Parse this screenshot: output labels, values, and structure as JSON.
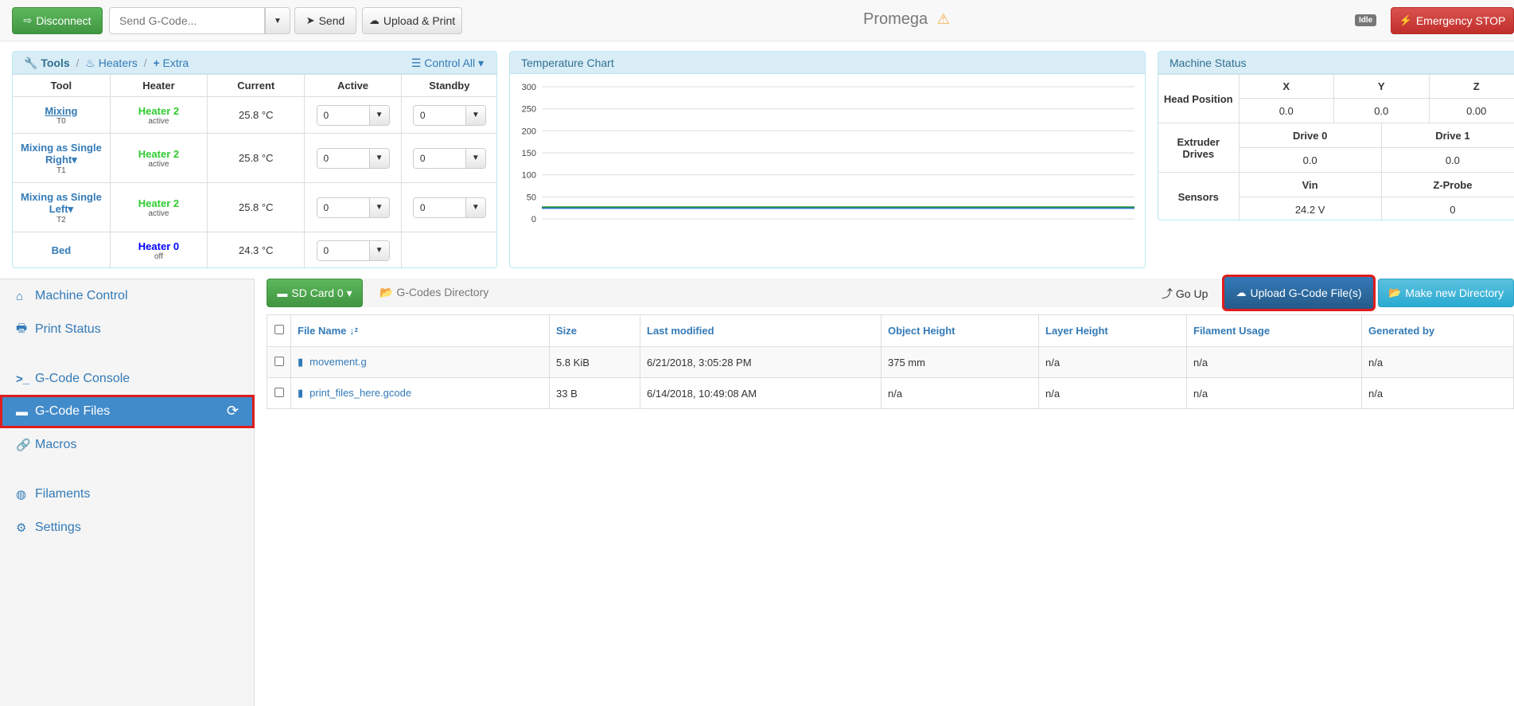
{
  "topbar": {
    "disconnect_label": "Disconnect",
    "gcode_placeholder": "Send G-Code...",
    "send_label": "Send",
    "upload_print_label": "Upload & Print",
    "machine_name": "Promega",
    "status_badge": "Idle",
    "emergency_label": "Emergency STOP"
  },
  "tools_panel": {
    "tab_tools": "Tools",
    "tab_heaters": "Heaters",
    "tab_extra": "Extra",
    "control_all": "Control All",
    "columns": [
      "Tool",
      "Heater",
      "Current",
      "Active",
      "Standby"
    ],
    "rows": [
      {
        "tool": "Mixing",
        "tool_sub": "T0",
        "heater": "Heater 2",
        "heater_state": "active",
        "current": "25.8 °C",
        "active": "0",
        "standby": "0"
      },
      {
        "tool": "Mixing as Single Right",
        "tool_sub": "T1",
        "heater": "Heater 2",
        "heater_state": "active",
        "current": "25.8 °C",
        "active": "0",
        "standby": "0"
      },
      {
        "tool": "Mixing as Single Left",
        "tool_sub": "T2",
        "heater": "Heater 2",
        "heater_state": "active",
        "current": "25.8 °C",
        "active": "0",
        "standby": "0"
      },
      {
        "tool": "Bed",
        "tool_sub": "",
        "heater": "Heater 0",
        "heater_state": "off",
        "current": "24.3 °C",
        "active": "0",
        "standby": ""
      }
    ]
  },
  "temperature_chart": {
    "title": "Temperature Chart",
    "chart_data": {
      "type": "line",
      "ylim": [
        0,
        300
      ],
      "y_ticks": [
        300,
        250,
        200,
        150,
        100,
        50,
        0
      ],
      "grid": true,
      "series": [
        {
          "color": "#2b9a2b",
          "values": [
            25.8,
            25.8,
            25.8,
            25.8,
            25.8,
            25.8,
            25.8,
            25.8,
            25.8,
            25.8,
            25.8,
            25.8
          ]
        },
        {
          "color": "#1f6fd1",
          "values": [
            24.3,
            24.3,
            24.3,
            24.3,
            24.3,
            24.3,
            24.3,
            24.3,
            24.3,
            24.3,
            24.3,
            24.3
          ]
        }
      ]
    }
  },
  "machine_status": {
    "title": "Machine Status",
    "head_position_label": "Head Position",
    "axes": [
      {
        "name": "X",
        "value": "0.0"
      },
      {
        "name": "Y",
        "value": "0.0"
      },
      {
        "name": "Z",
        "value": "0.00"
      }
    ],
    "extruder_label": "Extruder Drives",
    "drives": [
      {
        "name": "Drive 0",
        "value": "0.0"
      },
      {
        "name": "Drive 1",
        "value": "0.0"
      }
    ],
    "sensors_label": "Sensors",
    "sensors": [
      {
        "name": "Vin",
        "value": "24.2 V"
      },
      {
        "name": "Z-Probe",
        "value": "0"
      }
    ]
  },
  "sidebar": {
    "items": [
      {
        "label": "Machine Control",
        "icon": "home-icon"
      },
      {
        "label": "Print Status",
        "icon": "print-icon"
      },
      {
        "label": "G-Code Console",
        "icon": "console-icon"
      },
      {
        "label": "G-Code Files",
        "icon": "hdd-icon"
      },
      {
        "label": "Macros",
        "icon": "link-icon"
      },
      {
        "label": "Filaments",
        "icon": "globe-icon"
      },
      {
        "label": "Settings",
        "icon": "gear-icon"
      }
    ]
  },
  "files": {
    "sd_card_label": "SD Card 0",
    "directory_label": "G-Codes Directory",
    "go_up_label": "Go Up",
    "upload_label": "Upload G-Code File(s)",
    "new_dir_label": "Make new Directory",
    "columns": [
      "File Name",
      "Size",
      "Last modified",
      "Object Height",
      "Layer Height",
      "Filament Usage",
      "Generated by"
    ],
    "rows": [
      {
        "name": "movement.g",
        "size": "5.8 KiB",
        "modified": "6/21/2018, 3:05:28 PM",
        "object_height": "375 mm",
        "layer_height": "n/a",
        "filament": "n/a",
        "generated_by": "n/a"
      },
      {
        "name": "print_files_here.gcode",
        "size": "33 B",
        "modified": "6/14/2018, 10:49:08 AM",
        "object_height": "n/a",
        "layer_height": "n/a",
        "filament": "n/a",
        "generated_by": "n/a"
      }
    ]
  }
}
